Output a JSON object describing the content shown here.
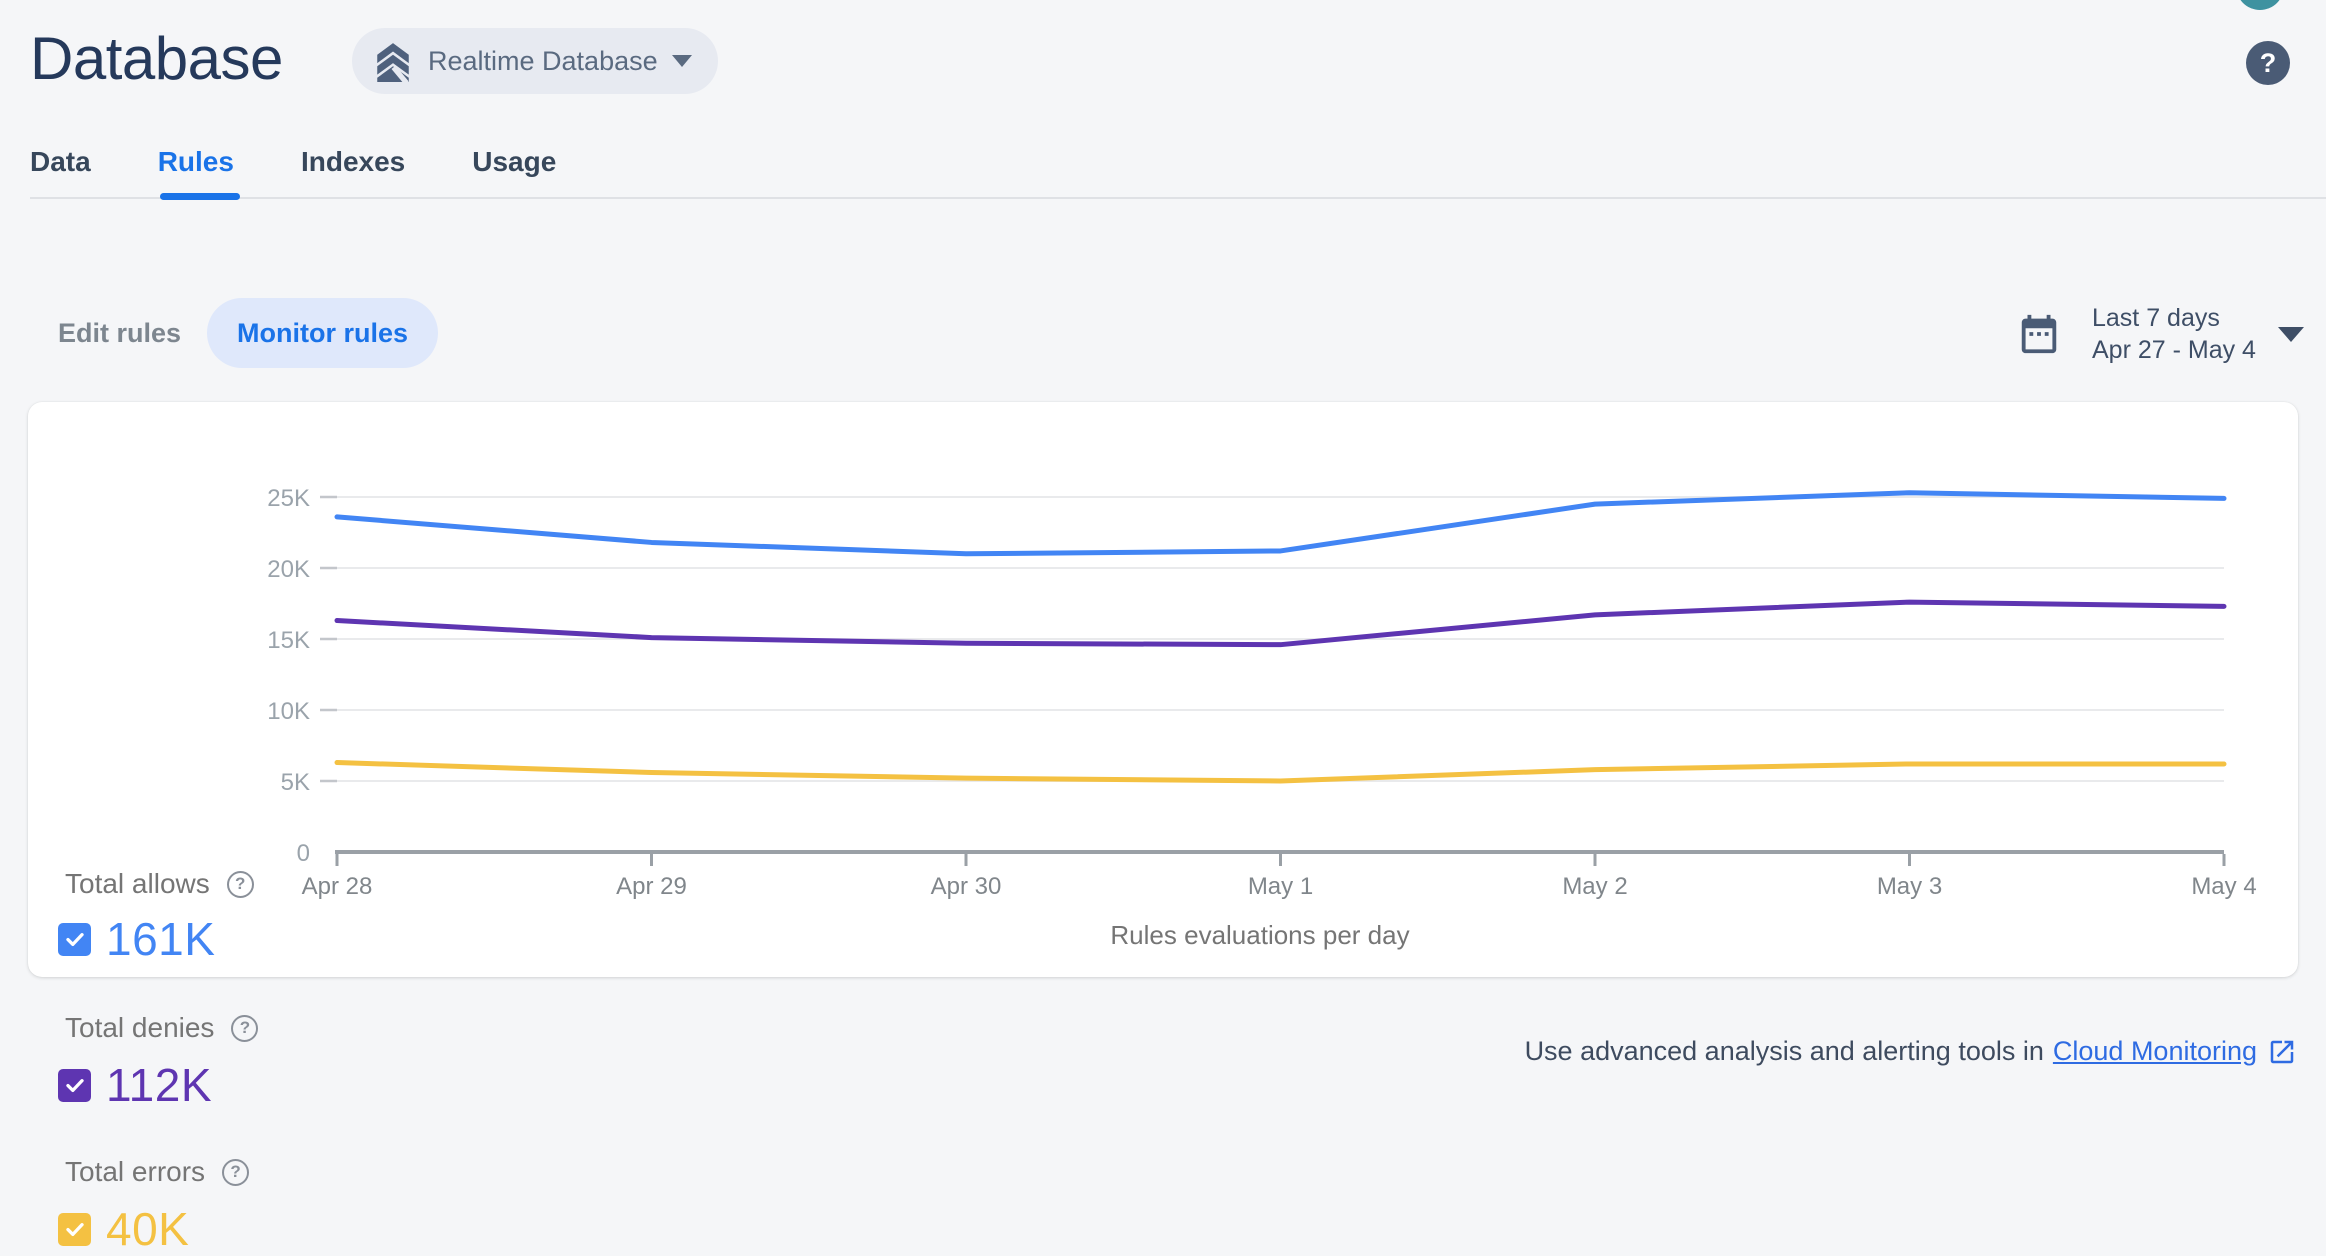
{
  "header": {
    "title": "Database",
    "chip_label": "Realtime Database",
    "help_glyph": "?"
  },
  "tabs": {
    "items": [
      {
        "label": "Data"
      },
      {
        "label": "Rules"
      },
      {
        "label": "Indexes"
      },
      {
        "label": "Usage"
      }
    ],
    "active": "Rules"
  },
  "controls": {
    "edit_rules_label": "Edit rules",
    "monitor_rules_label": "Monitor rules",
    "date_range": {
      "line1": "Last 7 days",
      "line2": "Apr 27 - May 4"
    }
  },
  "legend": {
    "allows": {
      "label": "Total allows",
      "value": "161K"
    },
    "denies": {
      "label": "Total denies",
      "value": "112K"
    },
    "errors": {
      "label": "Total errors",
      "value": "40K"
    }
  },
  "colors": {
    "allows": "#4285F4",
    "denies": "#5E35B1",
    "errors": "#F4C142",
    "active_blue": "#1A73E8",
    "link_blue": "#2E6BE2"
  },
  "chart_data": {
    "type": "line",
    "title": "Rules evaluations per day",
    "categories": [
      "Apr 28",
      "Apr 29",
      "Apr 30",
      "May 1",
      "May 2",
      "May 3",
      "May 4"
    ],
    "series": [
      {
        "name": "Total allows",
        "color": "#4285F4",
        "values": [
          23600,
          21800,
          21000,
          21200,
          24500,
          25300,
          24900
        ]
      },
      {
        "name": "Total denies",
        "color": "#5E35B1",
        "values": [
          16300,
          15100,
          14700,
          14600,
          16700,
          17600,
          17300
        ]
      },
      {
        "name": "Total errors",
        "color": "#F4C142",
        "values": [
          6300,
          5600,
          5200,
          5000,
          5800,
          6200,
          6200
        ]
      }
    ],
    "y_ticks": [
      {
        "value": 0,
        "label": "0"
      },
      {
        "value": 5000,
        "label": "5K"
      },
      {
        "value": 10000,
        "label": "10K"
      },
      {
        "value": 15000,
        "label": "15K"
      },
      {
        "value": 20000,
        "label": "20K"
      },
      {
        "value": 25000,
        "label": "25K"
      }
    ],
    "ylim": [
      0,
      26000
    ],
    "grid": true,
    "legend_position": "left"
  },
  "footer": {
    "text": "Use advanced analysis and alerting tools in",
    "link_label": "Cloud Monitoring"
  }
}
